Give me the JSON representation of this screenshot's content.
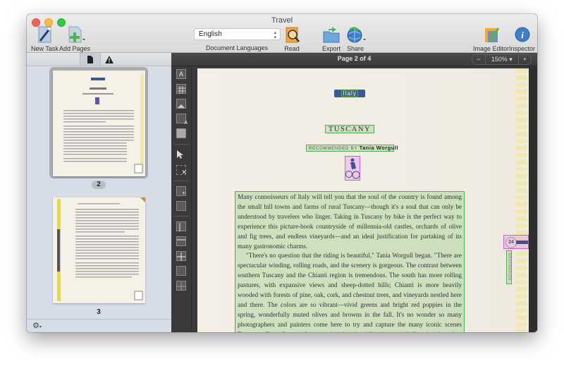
{
  "window": {
    "title": "Travel"
  },
  "toolbar": {
    "new_task": "New Task",
    "add_pages": "Add Pages",
    "language_value": "English",
    "language_label": "Document Languages",
    "read": "Read",
    "export": "Export",
    "share": "Share",
    "image_editor": "Image Editor",
    "inspector": "Inspector"
  },
  "sidebar": {
    "tabs": [
      {
        "icon": "page-icon",
        "active": true
      },
      {
        "icon": "warning-icon",
        "active": false
      }
    ],
    "pages": [
      {
        "number": "2",
        "selected": true
      },
      {
        "number": "3",
        "selected": false
      }
    ]
  },
  "viewer": {
    "page_indicator": "Page 2 of 4",
    "zoom_out": "−",
    "zoom_level": "150% ▾",
    "zoom_in": "+"
  },
  "tools": [
    "text-area",
    "table-area",
    "picture-area",
    "background-picture-area",
    "barcode-area",
    "select-area",
    "delete-area",
    "add-to-area",
    "subtract-from-area",
    "vertical-separator",
    "horizontal-separator",
    "delete-separator",
    "merge-cells",
    "split-cells"
  ],
  "document": {
    "tag": "Italy",
    "heading": "TUSCANY",
    "byline_prefix": "RECOMMENDED BY",
    "byline_name": "Tania Worgull",
    "page_badge": "24",
    "side_label": "DESTINATION",
    "paragraphs": [
      "Many connoisseurs of Italy will tell you that the soul of the country is found among the small hill towns and farms of rural Tuscany—though it's a soul that can only be understood by travelers who linger. Taking in Tuscany by bike is the perfect way to experience this picture-book countryside of millennia-old castles, orchards of olive and fig trees, and endless vineyards—and an ideal justification for partaking of its many gastronomic charms.",
      "\"There's no question that the riding is beautiful,\" Tania Worgull began. \"There are spectacular winding, rolling roads, and the scenery is gorgeous. The contrast between southern Tuscany and the Chianti region is tremendous. The south has more rolling pastures, with expansive views and sheep-dotted hills; Chianti is more heavily wooded with forests of pine, oak, cork, and chestnut trees, and vineyards nestled here and there. The colors are so vibrant—vivid greens and bright red poppies in the spring, wonderfully muted olives and browns in the fall. It's no wonder so many photographers and painters come here to try and capture the many iconic scenes Tuscany offers. Guests often mention that the riding is more challenging than they imagined, hillier, but within reach for less-seasoned riders. But a cycling tour of Tuscany goes beyond what you experience in"
    ]
  },
  "colors": {
    "text_zone": "#4caf50",
    "picture_zone": "#d35bd8",
    "tag_blue": "#3c5a92"
  }
}
